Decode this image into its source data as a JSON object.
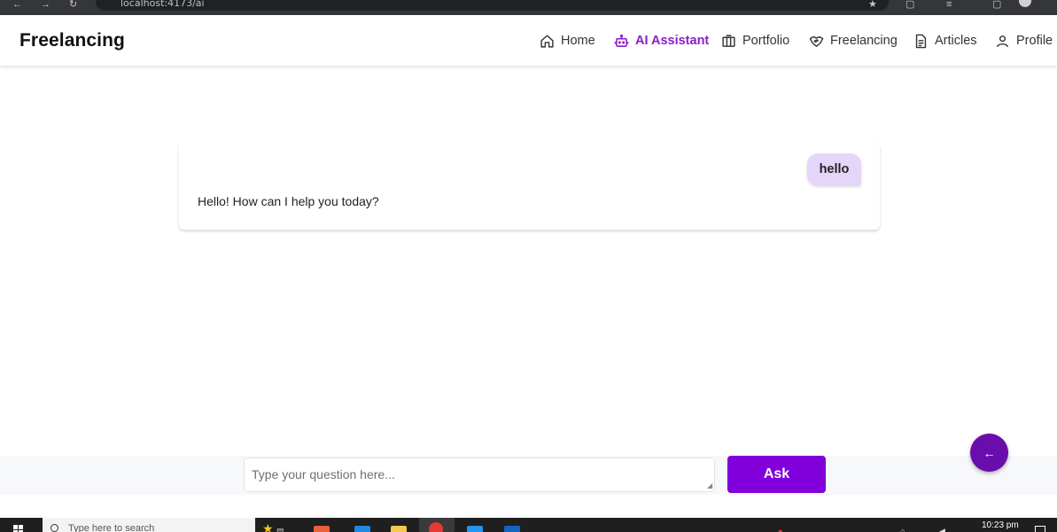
{
  "browser": {
    "url": "localhost:4173/ai"
  },
  "navbar": {
    "brand": "Freelancing",
    "items": [
      {
        "label": "Home",
        "icon": "home-icon",
        "active": false
      },
      {
        "label": "AI Assistant",
        "icon": "robot-icon",
        "active": true
      },
      {
        "label": "Portfolio",
        "icon": "columns-icon",
        "active": false
      },
      {
        "label": "Freelancing",
        "icon": "handshake-icon",
        "active": false
      },
      {
        "label": "Articles",
        "icon": "document-icon",
        "active": false
      },
      {
        "label": "Profile",
        "icon": "user-icon",
        "active": false
      }
    ]
  },
  "chat": {
    "messages": [
      {
        "role": "user",
        "text": "hello"
      },
      {
        "role": "assistant",
        "text": "Hello! How can I help you today?"
      }
    ]
  },
  "composer": {
    "placeholder": "Type your question here...",
    "value": "",
    "ask_label": "Ask",
    "back_glyph": "←"
  },
  "taskbar": {
    "search_text": "Type here to search",
    "clock": "10:23 pm"
  },
  "colors": {
    "accent": "#8200db",
    "accent_dark": "#6a0dad",
    "active_nav": "#8a1ec7",
    "user_bubble": "#e6d5fa"
  }
}
